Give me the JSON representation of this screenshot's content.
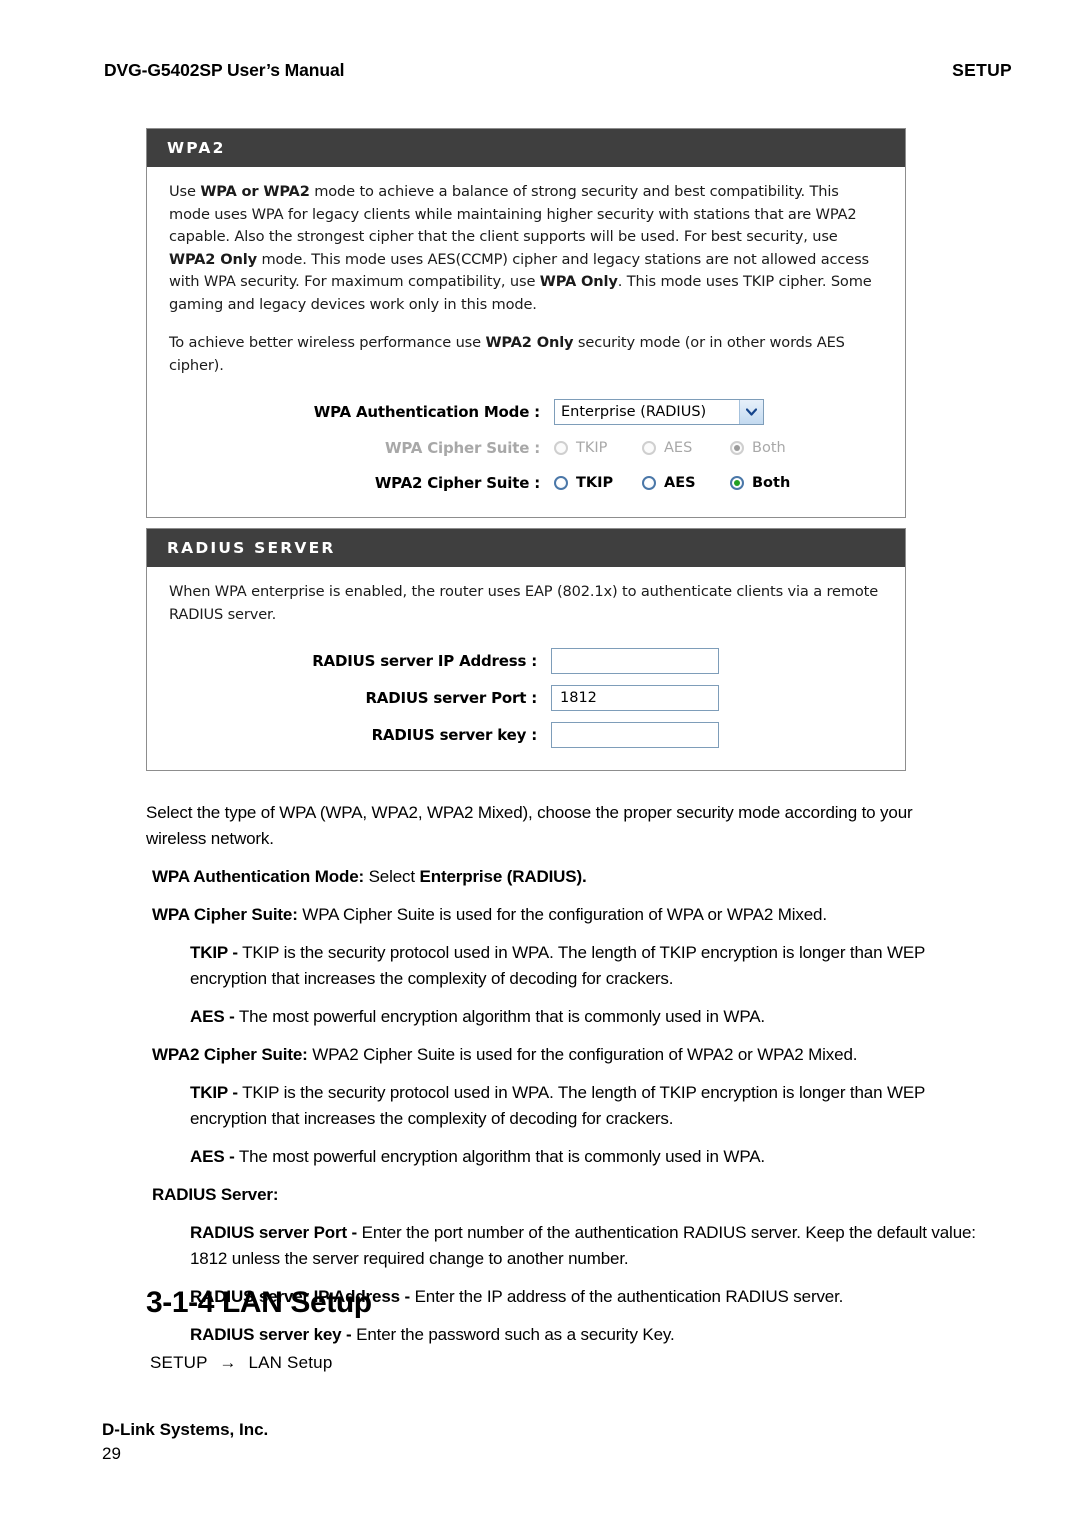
{
  "header": {
    "manual_title": "DVG-G5402SP User’s Manual",
    "section_tag": "SETUP"
  },
  "wpa2_panel": {
    "title": "WPA2",
    "paragraphs": [
      {
        "runs": [
          {
            "t": "Use ",
            "b": false
          },
          {
            "t": "WPA or WPA2",
            "b": true
          },
          {
            "t": " mode to achieve a balance of strong security and best compatibility. This mode uses WPA for legacy clients while maintaining higher security with stations that are WPA2 capable. Also the strongest cipher that the client supports will be used. For best security, use ",
            "b": false
          },
          {
            "t": "WPA2 Only",
            "b": true
          },
          {
            "t": " mode. This mode uses AES(CCMP) cipher and legacy stations are not allowed access with WPA security. For maximum compatibility, use ",
            "b": false
          },
          {
            "t": "WPA Only",
            "b": true
          },
          {
            "t": ". This mode uses TKIP cipher. Some gaming and legacy devices work only in this mode.",
            "b": false
          }
        ]
      },
      {
        "runs": [
          {
            "t": "To achieve better wireless performance use ",
            "b": false
          },
          {
            "t": "WPA2 Only",
            "b": true
          },
          {
            "t": " security mode (or in other words AES cipher).",
            "b": false
          }
        ]
      }
    ],
    "auth_mode": {
      "label": "WPA Authentication Mode  :",
      "value": "Enterprise (RADIUS)",
      "options": [
        "Enterprise (RADIUS)"
      ]
    },
    "wpa_cipher_suite": {
      "label": "WPA Cipher Suite :",
      "disabled": true,
      "selected": "Both",
      "options": [
        "TKIP",
        "AES",
        "Both"
      ]
    },
    "wpa2_cipher_suite": {
      "label": "WPA2 Cipher Suite :",
      "disabled": false,
      "selected": "Both",
      "options": [
        "TKIP",
        "AES",
        "Both"
      ]
    }
  },
  "radius_panel": {
    "title": "RADIUS SERVER",
    "description": "When WPA enterprise is enabled, the router uses EAP (802.1x) to authenticate clients via a remote RADIUS server.",
    "fields": [
      {
        "label": "RADIUS server IP Address  :",
        "value": ""
      },
      {
        "label": "RADIUS server Port  :",
        "value": "1812"
      },
      {
        "label": "RADIUS server key  :",
        "value": ""
      }
    ]
  },
  "body": {
    "intro": {
      "runs": [
        {
          "t": "Select the type of WPA (WPA, WPA2, WPA2 Mixed), choose the proper security mode according to your wireless network.",
          "b": false
        }
      ]
    },
    "items": [
      {
        "indent": 1,
        "runs": [
          {
            "t": "WPA Authentication Mode:",
            "b": true
          },
          {
            "t": " Select ",
            "b": false
          },
          {
            "t": "Enterprise (RADIUS).",
            "b": true
          }
        ]
      },
      {
        "indent": 1,
        "runs": [
          {
            "t": "WPA Cipher Suite:",
            "b": true
          },
          {
            "t": " WPA Cipher Suite is used for the configuration of WPA or WPA2 Mixed.",
            "b": false
          }
        ]
      },
      {
        "indent": 2,
        "runs": [
          {
            "t": "TKIP -",
            "b": true
          },
          {
            "t": " TKIP is the security protocol used in WPA. The length of TKIP encryption is longer than WEP encryption that increases the complexity of decoding for crackers.",
            "b": false
          }
        ]
      },
      {
        "indent": 2,
        "runs": [
          {
            "t": "AES -",
            "b": true
          },
          {
            "t": " The most powerful encryption algorithm that is commonly used in WPA.",
            "b": false
          }
        ]
      },
      {
        "indent": 1,
        "runs": [
          {
            "t": "WPA2 Cipher Suite:",
            "b": true
          },
          {
            "t": " WPA2 Cipher Suite is used for the configuration of WPA2 or WPA2 Mixed.",
            "b": false
          }
        ]
      },
      {
        "indent": 2,
        "runs": [
          {
            "t": "TKIP -",
            "b": true
          },
          {
            "t": " TKIP is the security protocol used in WPA. The length of TKIP encryption is longer than WEP encryption that increases the complexity of decoding for crackers.",
            "b": false
          }
        ]
      },
      {
        "indent": 2,
        "runs": [
          {
            "t": "AES -",
            "b": true
          },
          {
            "t": " The most powerful encryption algorithm that is commonly used in WPA.",
            "b": false
          }
        ]
      },
      {
        "indent": 1,
        "runs": [
          {
            "t": "RADIUS Server:",
            "b": true
          }
        ]
      },
      {
        "indent": 2,
        "runs": [
          {
            "t": "RADIUS server Port -",
            "b": true
          },
          {
            "t": " Enter the port number of the authentication RADIUS server. Keep the default value: 1812 unless the server required change to another number.",
            "b": false
          }
        ]
      },
      {
        "indent": 2,
        "runs": [
          {
            "t": "RADIUS server IP Address -",
            "b": true
          },
          {
            "t": " Enter the IP address of the authentication RADIUS server.",
            "b": false
          }
        ]
      },
      {
        "indent": 2,
        "runs": [
          {
            "t": "RADIUS server key -",
            "b": true
          },
          {
            "t": " Enter the password such as a security Key.",
            "b": false
          }
        ]
      }
    ]
  },
  "section": {
    "heading": "3-1-4 LAN Setup",
    "breadcrumb_root": "SETUP",
    "breadcrumb_arrow": "→",
    "breadcrumb_leaf": "LAN Setup"
  },
  "footer": {
    "company": "D-Link Systems, Inc.",
    "page_number": "29"
  }
}
